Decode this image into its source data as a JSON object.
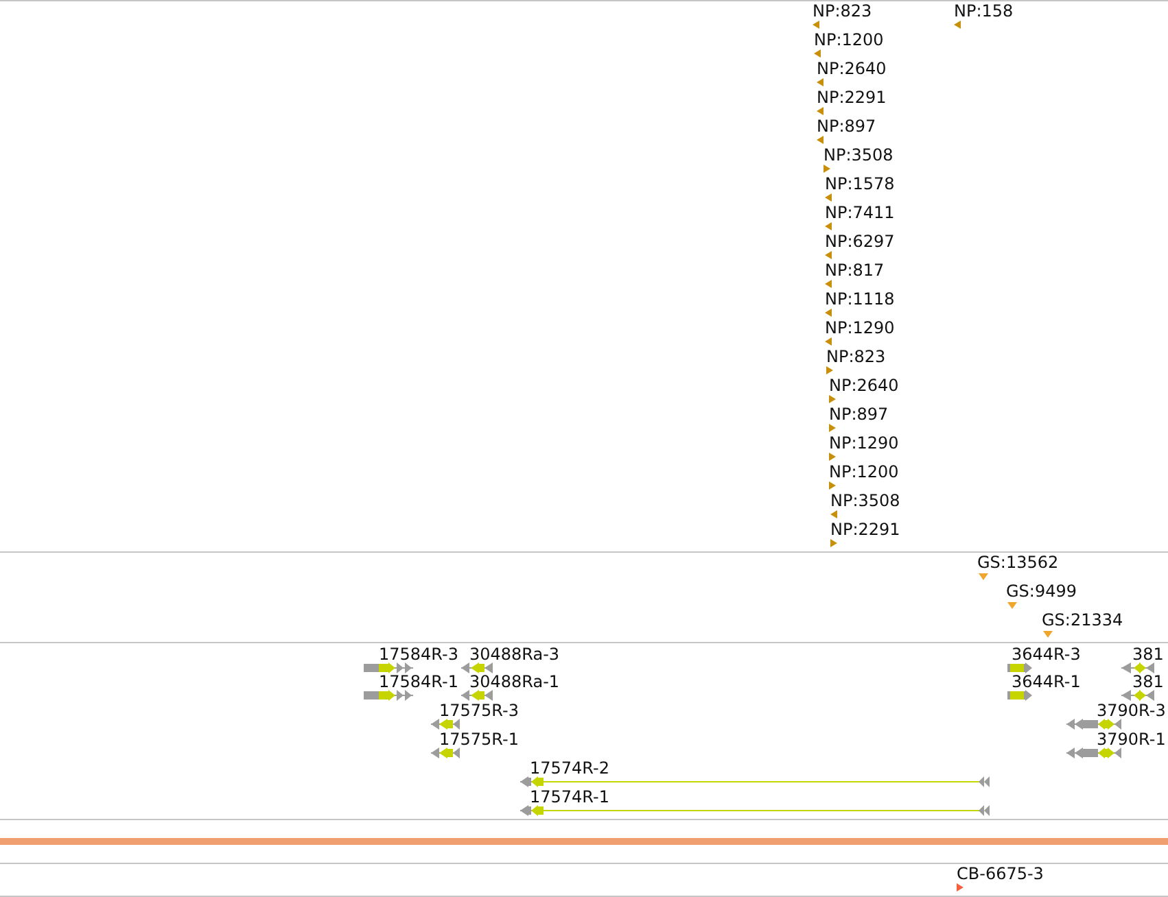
{
  "tracks": [
    {
      "kind": "markers",
      "color": "#c8900a",
      "features": [
        {
          "label": "NP:823",
          "reverse": true
        },
        {
          "label": "NP:158",
          "reverse": true
        },
        {
          "label": "NP:1200",
          "reverse": true
        },
        {
          "label": "NP:2640",
          "reverse": true
        },
        {
          "label": "NP:2291",
          "reverse": true
        },
        {
          "label": "NP:897",
          "reverse": true
        },
        {
          "label": "NP:3508",
          "reverse": false
        },
        {
          "label": "NP:1578",
          "reverse": true
        },
        {
          "label": "NP:7411",
          "reverse": true
        },
        {
          "label": "NP:6297",
          "reverse": true
        },
        {
          "label": "NP:817",
          "reverse": true
        },
        {
          "label": "NP:1118",
          "reverse": true
        },
        {
          "label": "NP:1290",
          "reverse": true
        },
        {
          "label": "NP:823",
          "reverse": false
        },
        {
          "label": "NP:2640",
          "reverse": false
        },
        {
          "label": "NP:897",
          "reverse": false
        },
        {
          "label": "NP:1290",
          "reverse": false
        },
        {
          "label": "NP:1200",
          "reverse": false
        },
        {
          "label": "NP:3508",
          "reverse": true
        },
        {
          "label": "NP:2291",
          "reverse": false
        }
      ]
    },
    {
      "kind": "sites",
      "color": "#eea62c",
      "features": [
        {
          "label": "GS:13562"
        },
        {
          "label": "GS:9499"
        },
        {
          "label": "GS:21334"
        }
      ]
    },
    {
      "kind": "genes",
      "features": [
        {
          "label": "17584R-3",
          "reverse": false
        },
        {
          "label": "30488Ra-3",
          "reverse": true
        },
        {
          "label": "3644R-3",
          "reverse": false
        },
        {
          "label": "381",
          "reverse": true
        },
        {
          "label": "17584R-1",
          "reverse": false
        },
        {
          "label": "30488Ra-1",
          "reverse": true
        },
        {
          "label": "3644R-1",
          "reverse": false
        },
        {
          "label": "381",
          "reverse": true
        },
        {
          "label": "17575R-3",
          "reverse": true
        },
        {
          "label": "3790R-3",
          "reverse": true
        },
        {
          "label": "17575R-1",
          "reverse": true
        },
        {
          "label": "3790R-1",
          "reverse": true
        },
        {
          "label": "17574R-2",
          "reverse": true
        },
        {
          "label": "17574R-1",
          "reverse": true
        }
      ]
    },
    {
      "kind": "band"
    },
    {
      "kind": "markers",
      "color": "#f2603e",
      "features": [
        {
          "label": "CB-6675-3",
          "reverse": false
        }
      ]
    }
  ]
}
